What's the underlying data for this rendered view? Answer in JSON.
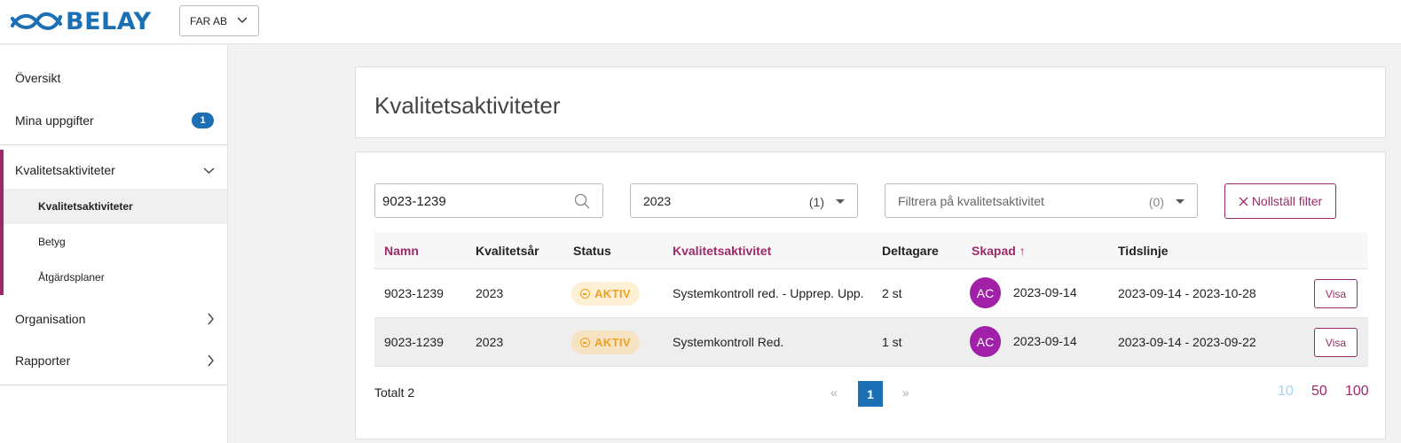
{
  "header": {
    "logo_text": "BELAY",
    "org_selector": "FAR AB"
  },
  "sidebar": {
    "overview": "Översikt",
    "my_tasks": "Mina uppgifter",
    "my_tasks_badge": "1",
    "quality_group": "Kvalitetsaktiviteter",
    "sub_items": [
      "Kvalitetsaktiviteter",
      "Betyg",
      "Åtgärdsplaner"
    ],
    "organisation": "Organisation",
    "reports": "Rapporter"
  },
  "page": {
    "title": "Kvalitetsaktiviteter"
  },
  "filters": {
    "search_value": "9023-1239",
    "year_value": "2023",
    "year_count": "(1)",
    "activity_placeholder": "Filtrera på kvalitetsaktivitet",
    "activity_count": "(0)",
    "reset_label": "Nollställ filter"
  },
  "table": {
    "headers": {
      "name": "Namn",
      "year": "Kvalitetsår",
      "status": "Status",
      "activity": "Kvalitetsaktivitet",
      "participants": "Deltagare",
      "created": "Skapad",
      "created_sort": "↑",
      "timeline": "Tidslinje"
    },
    "rows": [
      {
        "name": "9023-1239",
        "year": "2023",
        "status": "AKTIV",
        "activity": "Systemkontroll red. - Upprep. Upp.",
        "participants": "2 st",
        "avatar": "AC",
        "created": "2023-09-14",
        "timeline": "2023-09-14 - 2023-10-28",
        "action": "Visa"
      },
      {
        "name": "9023-1239",
        "year": "2023",
        "status": "AKTIV",
        "activity": "Systemkontroll Red.",
        "participants": "1 st",
        "avatar": "AC",
        "created": "2023-09-14",
        "timeline": "2023-09-14 - 2023-09-22",
        "action": "Visa"
      }
    ]
  },
  "footer": {
    "total": "Totalt 2",
    "prev": "«",
    "current_page": "1",
    "next": "»",
    "page_sizes": [
      "10",
      "50",
      "100"
    ],
    "active_page_size": "10"
  },
  "colors": {
    "brand_blue": "#1a6fb5",
    "accent_magenta": "#9c2a6a",
    "status_orange": "#f0a020",
    "avatar_purple": "#a020a8"
  }
}
